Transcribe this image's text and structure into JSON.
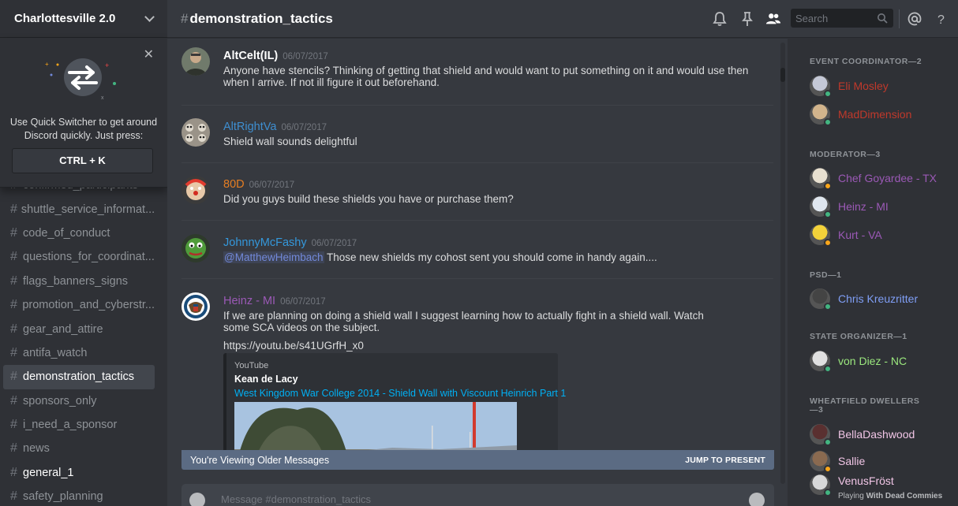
{
  "server": {
    "name": "Charlottesville 2.0"
  },
  "quick_switcher": {
    "text": "Use Quick Switcher to get around Discord quickly. Just press:",
    "shortcut": "CTRL + K"
  },
  "channels": [
    {
      "name": "confirmed_participants",
      "state": "partial"
    },
    {
      "name": "shuttle_service_informat...",
      "state": "normal"
    },
    {
      "name": "code_of_conduct",
      "state": "normal"
    },
    {
      "name": "questions_for_coordinat...",
      "state": "normal"
    },
    {
      "name": "flags_banners_signs",
      "state": "normal"
    },
    {
      "name": "promotion_and_cyberstr...",
      "state": "normal"
    },
    {
      "name": "gear_and_attire",
      "state": "normal"
    },
    {
      "name": "antifa_watch",
      "state": "normal"
    },
    {
      "name": "demonstration_tactics",
      "state": "active"
    },
    {
      "name": "sponsors_only",
      "state": "normal"
    },
    {
      "name": "i_need_a_sponsor",
      "state": "normal"
    },
    {
      "name": "news",
      "state": "normal"
    },
    {
      "name": "general_1",
      "state": "unread"
    },
    {
      "name": "safety_planning",
      "state": "partial"
    }
  ],
  "header": {
    "channel": "demonstration_tactics",
    "search_placeholder": "Search",
    "icons": [
      "bell-icon",
      "pin-icon",
      "members-icon",
      "search-icon",
      "at-icon",
      "help-icon"
    ]
  },
  "messages": [
    {
      "user": "AltCelt(IL)",
      "color": "#ffffff",
      "time": "06/07/2017",
      "text": "Anyone have stencils? Thinking of getting that shield and would want to put something on it and would use then when I arrive. If not ill figure it out beforehand."
    },
    {
      "user": "AltRightVa",
      "color": "#3e8ed0",
      "time": "06/07/2017",
      "text": "Shield wall sounds delightful"
    },
    {
      "user": "80D",
      "color": "#e67e22",
      "time": "06/07/2017",
      "text": "Did you guys build these shields you have or purchase them?"
    },
    {
      "user": "JohnnyMcFashy",
      "color": "#3498db",
      "time": "06/07/2017",
      "mention": "@MatthewHeimbach",
      "text": " Those new shields my cohost sent you should come in handy again...."
    },
    {
      "user": "Heinz - MI",
      "color": "#9b59b6",
      "time": "06/07/2017",
      "text": "If we are planning on doing a shield wall I suggest learning how to actually fight in a shield wall. Watch some SCA videos on the subject.",
      "link": "https://youtu.be/s41UGrfH_x0"
    }
  ],
  "embed": {
    "provider": "YouTube",
    "author": "Kean de Lacy",
    "title": "West Kingdom War College 2014 - Shield Wall with Viscount Heinrich Part 1"
  },
  "older_bar": {
    "text": "You're Viewing Older Messages",
    "action": "JUMP TO PRESENT"
  },
  "composer": {
    "placeholder": "Message #demonstration_tactics"
  },
  "member_groups": [
    {
      "role": "EVENT COORDINATOR—2",
      "members": [
        {
          "name": "Eli Mosley",
          "color": "#c0392b",
          "status": "online"
        },
        {
          "name": "MadDimension",
          "color": "#c0392b",
          "status": "online"
        }
      ]
    },
    {
      "role": "MODERATOR—3",
      "members": [
        {
          "name": "Chef Goyardee - TX",
          "color": "#9b59b6",
          "status": "idle"
        },
        {
          "name": "Heinz - MI",
          "color": "#9b59b6",
          "status": "online"
        },
        {
          "name": "Kurt - VA",
          "color": "#9b59b6",
          "status": "idle"
        }
      ]
    },
    {
      "role": "PSD—1",
      "members": [
        {
          "name": "Chris Kreuzritter",
          "color": "#7f9ef5",
          "status": "online"
        }
      ]
    },
    {
      "role": "STATE ORGANIZER—1",
      "members": [
        {
          "name": "von Diez - NC",
          "color": "#9be87e",
          "status": "online"
        }
      ]
    },
    {
      "role": "WHEATFIELD DWELLERS—3",
      "members": [
        {
          "name": "BellaDashwood",
          "color": "#f1c5e6",
          "status": "online"
        },
        {
          "name": "Sallie",
          "color": "#f1c5e6",
          "status": "idle"
        },
        {
          "name": "VenusFröst",
          "color": "#f1c5e6",
          "status": "online",
          "game_prefix": "Playing ",
          "game": "With Dead Commies"
        }
      ]
    }
  ]
}
